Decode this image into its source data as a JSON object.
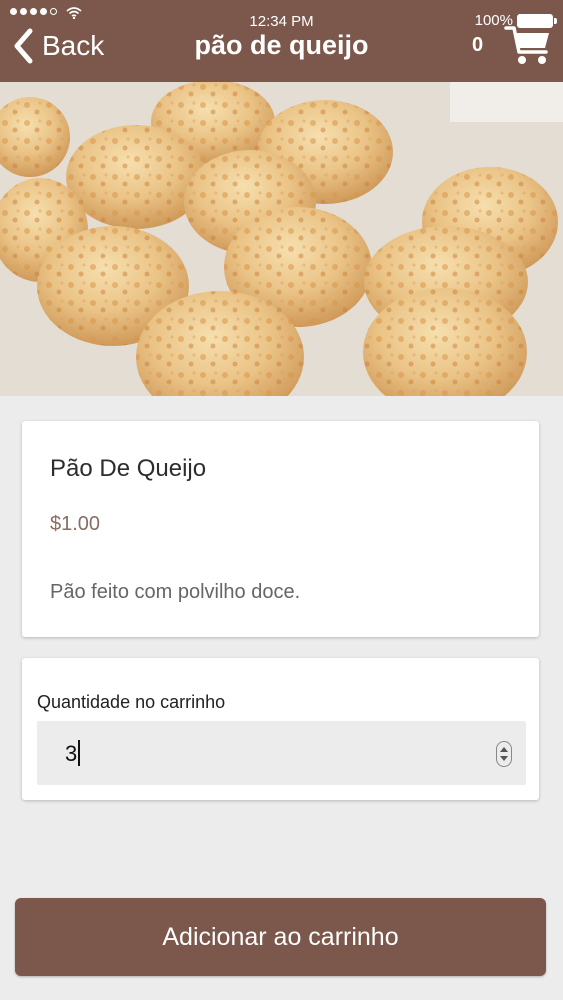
{
  "status_bar": {
    "time": "12:34 PM",
    "battery": "100%",
    "signal_icon": "signal-dots-icon",
    "wifi_icon": "wifi-icon",
    "battery_icon": "battery-icon"
  },
  "nav": {
    "back_label": "Back",
    "back_icon": "chevron-left-icon",
    "title": "pão de queijo",
    "cart_count": "0",
    "cart_icon": "shopping-cart-icon"
  },
  "hero_image": {
    "subject": "cheese-bread-photo"
  },
  "product": {
    "name": "Pão De Queijo",
    "price": "$1.00",
    "description": "Pão feito com polvilho doce."
  },
  "quantity": {
    "label": "Quantidade no carrinho",
    "value": "3",
    "stepper_icon": "number-stepper-icon"
  },
  "actions": {
    "add_to_cart_label": "Adicionar ao carrinho"
  },
  "colors": {
    "brand": "#7b584b",
    "background": "#ececec",
    "price": "#8a6d63"
  }
}
